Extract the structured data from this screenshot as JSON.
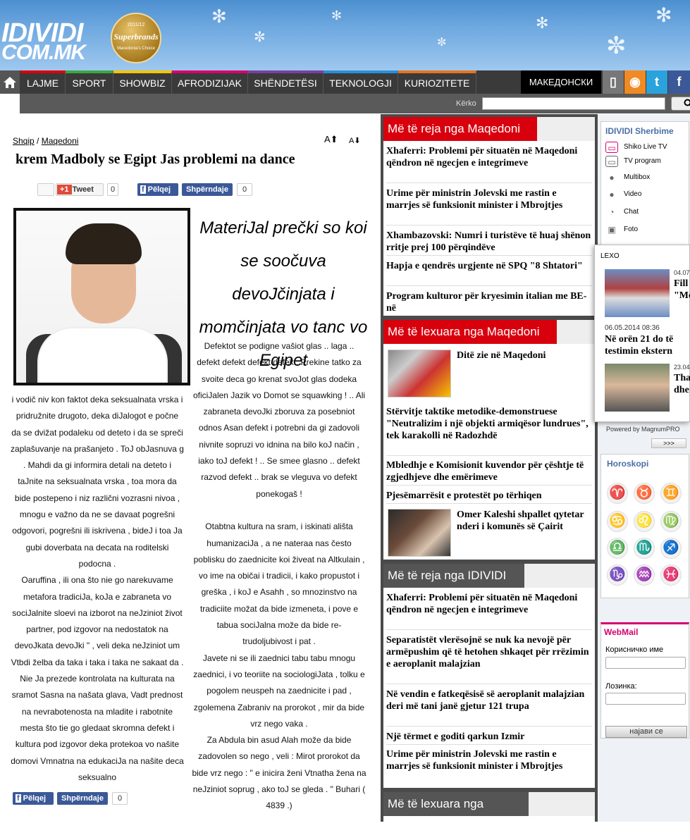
{
  "header": {
    "logo_line1": "IDIVIDI",
    "logo_line2": "COM.MK",
    "badge_years": "2011/12",
    "badge_brand": "Superbrands",
    "badge_caption": "Macedonia's Choice"
  },
  "nav": {
    "items": [
      {
        "label": "LAJME",
        "color": "#d9000d"
      },
      {
        "label": "SPORT",
        "color": "#3aa843"
      },
      {
        "label": "SHOWBIZ",
        "color": "#f5c400"
      },
      {
        "label": "AFRODIZIJAK",
        "color": "#d6006f"
      },
      {
        "label": "SHËNDETËSI",
        "color": "#7b3fa0"
      },
      {
        "label": "TEKNOLOGJI",
        "color": "#2a8fd6"
      },
      {
        "label": "KURIOZITETE",
        "color": "#e8731f"
      }
    ],
    "lang_label": "МАКЕДОНСКИ",
    "social": [
      "mobile-icon",
      "rss-icon",
      "twitter-icon",
      "facebook-icon"
    ]
  },
  "search": {
    "label": "Kërko",
    "value": "",
    "button_icon": "search-icon"
  },
  "article": {
    "breadcrumb": [
      "Shqip",
      "Maqedoni"
    ],
    "breadcrumb_sep": " / ",
    "font_up": "A⬆",
    "font_down": "A⬇",
    "title": "krem Madboly se Egipt Jas problemi na dance",
    "share_top": {
      "plus": "+1",
      "tweet": "Tweet",
      "tweet_count": "0",
      "like": "Pëlqej",
      "share": "Shpërndaje",
      "fb_count": "0"
    },
    "image_caption": "MateriJal prečki so koi se soočuva devoJčinjata i momčinjata vo tanc vo Egipet",
    "col2_text": "Defektot se podigne vašiot glas .. laga .. defekt defekt defekt defekt. Prekine tatko za svoite deca go krenat svoJot glas dodeka oficiJalen Jazik vo Domot se squawking ! .. Ali zabraneta devoJki zboruva za posebniot odnos Asan defekt i potrebni da gi zadovoli nivnite sopruzi vo idnina na bilo koJ način , iako toJ defekt ! .. Se smee glasno .. defekt razvod defekt .. brak se vleguva vo defekt ponekogaš !\n\nOtabtna kultura na sram, i iskinati ališta humanizaciJa , a ne nateraa nas često poblisku do zaednicite koi živeat na Altkulain , vo ime na običai i tradicii, i kako propustot i greška , i koJ e Asahh , so mnozinstvo na tradiciite možat da bide izmeneta, i pove e tabua sociJalna može da bide re- trudoljubivost i pat .\nJavete ni se ili zaednici tabu tabu mnogu zaednici, i vo teoriite na sociologiJata , tolku e pogolem neuspeh na zaednicite i pad , zgolemena Zabraniv na prorokot , mir da bide vrz nego vaka .\nZa Abdula bin asud Alah može da bide zadovolen so nego , veli : Mirot prorokot da bide vrz nego : \" e inicira ženi Vtnatha žena na neJziniot soprug , ako toJ se gleda . \" Buhari ( 4839 .)",
    "col1_text": "i vodič niv kon faktot deka seksualnata vrska i pridružnite drugoto, deka diJalogot e počne da se dvižat podaleku od deteto i da se spreči zaplašuvanje na prašanjeto . ToJ obJasnuva g . Mahdi da gi informira detali na deteto i taJnite na seksualnata vrska , toa mora da bide postepeno i niz različni vozrasni nivoa , mnogu e važno da ne se davaat pogrešni odgovori, pogrešni ili iskrivena , bideJ i toa Ja gubi doverbata na decata na roditelski podocna .\nOaruffina , ili ona što nie go narekuvame metafora tradiciJa, koJa e zabraneta vo sociJalnite sloevi na izborot na neJziniot život partner, pod izgovor na nedostatok na devoJkata devoJki \" , veli deka neJziniot um Vtbdi želba da taka i taka i taka ne sakaat da .\nNie Ja prezede kontrolata na kulturata na sramot Sasna na našata glava, Vadt prednost na nevrabotenosta na mladite i rabotnite mesta što tie go gledaat skromna defekt i kultura pod izgovor deka protekoa vo našite domovi Vmnatna na edukaciJa na našite deca seksualno",
    "share_bottom": {
      "like": "Pëlqej",
      "share": "Shpërndaje",
      "fb_count": "0"
    }
  },
  "middle": {
    "sec1": {
      "title": "Më të reja nga Maqedoni",
      "items": [
        "Xhaferri: Problemi për situatën në Maqedoni qëndron në ngecjen e integrimeve",
        "Urime për ministrin Jolevski me rastin e marrjes së funksionit minister i Mbrojtjes",
        "Xhambazovski: Numri i turistëve të huaj shënon rritje prej 100 përqindëve",
        "Hapja e qendrës urgjente në SPQ \"8 Shtatori\"",
        "Program kulturor për kryesimin italian me BE-në"
      ]
    },
    "sec2": {
      "title": "Më të lexuara nga Maqedoni",
      "items": [
        "Ditë zie në Maqedoni",
        "Stërvitje taktike metodike-demonstruese \"Neutralizim i një objekti armiqësor lundrues\", tek karakolli në Radozhdë",
        "Mbledhje e Komisionit kuvendor për çështje të zgjedhjeve dhe emërimeve",
        "Pjesëmarrësit e protestët po tërhiqen",
        "Omer Kaleshi shpallet qytetar nderi i komunës së Çairit"
      ]
    },
    "sec3": {
      "title": "Më të reja nga IDIVIDI",
      "items": [
        "Xhaferri: Problemi për situatën në Maqedoni qëndron në ngecjen e integrimeve",
        "Separatistët vlerësojnë se nuk ka nevojë për armëpushim që të hetohen shkaqet për rrëzimin e aeroplanit malajzian",
        "Në vendin e fatkeqësisë së aeroplanit malajzian deri më tani janë gjetur 121 trupa",
        "Një tërmet e goditi qarkun Izmir",
        "Urime për ministrin Jolevski me rastin e marrjes së funksionit minister i Mbrojtjes"
      ]
    },
    "sec4": {
      "title": "Më të lexuara nga IDIVIDI"
    }
  },
  "right": {
    "services_title": "IDIVIDI Sherbime",
    "services": [
      {
        "label": "Shiko Live TV",
        "icon": "tv-icon"
      },
      {
        "label": "TV program",
        "icon": "tv-program-icon"
      },
      {
        "label": "Multibox",
        "icon": "multibox-icon"
      },
      {
        "label": "Video",
        "icon": "video-icon"
      },
      {
        "label": "Chat",
        "icon": "chat-icon"
      },
      {
        "label": "Foto",
        "icon": "photo-icon"
      }
    ],
    "popup": {
      "label": "LEXO",
      "date1": "04.07",
      "text1": "Fill \"Me",
      "date2": "06.05.2014 08:36",
      "text2": "Në orën 21 do të testimin ekstern",
      "date3": "23.04",
      "text3": "Tha dhe"
    },
    "powered_by": "Powered by MagnumPRO",
    "more_label": ">>>",
    "horoscope_title": "Horoskopi",
    "zodiac": [
      "♈",
      "♉",
      "♊",
      "♋",
      "♌",
      "♍",
      "♎",
      "♏",
      "♐",
      "♑",
      "♒",
      "♓"
    ],
    "webmail": {
      "title": "WebMail",
      "user_label": "Корисничко име",
      "pass_label": "Лозинка:",
      "button": "најави се"
    }
  }
}
